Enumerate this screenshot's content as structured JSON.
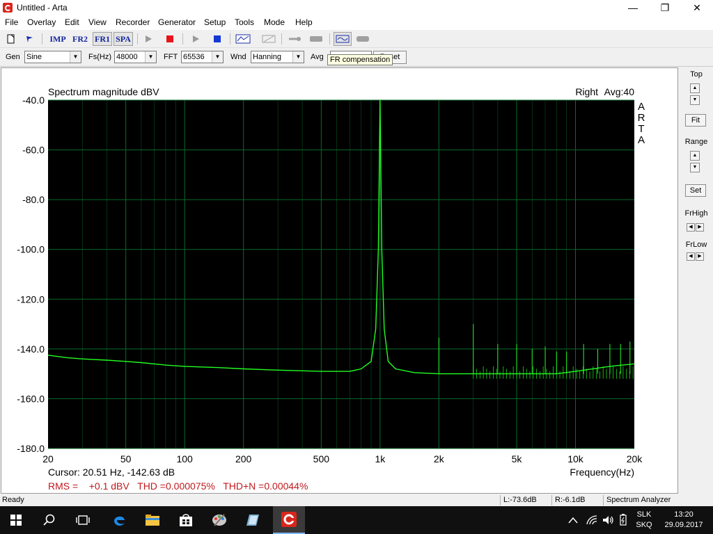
{
  "window": {
    "title": "Untitled - Arta"
  },
  "menu": [
    "File",
    "Overlay",
    "Edit",
    "View",
    "Recorder",
    "Generator",
    "Setup",
    "Tools",
    "Mode",
    "Help"
  ],
  "toolbar": {
    "imp": "IMP",
    "fr2": "FR2",
    "fr1": "FR1",
    "spa": "SPA"
  },
  "controls": {
    "gen_label": "Gen",
    "gen_value": "Sine",
    "fs_label": "Fs(Hz)",
    "fs_value": "48000",
    "fft_label": "FFT",
    "fft_value": "65536",
    "wnd_label": "Wnd",
    "wnd_value": "Hanning",
    "avg_label": "Avg",
    "reset_label": "Reset"
  },
  "tooltip": "FR compensation",
  "chart_data": {
    "type": "line",
    "title": "Spectrum magnitude dBV",
    "channel": "Right",
    "avg_text": "Avg:40",
    "brand": "ARTA",
    "xlabel": "Frequency(Hz)",
    "ylabel": "",
    "xscale": "log",
    "xlim": [
      20,
      20000
    ],
    "ylim": [
      -180,
      -40
    ],
    "yticks": [
      -40,
      -60,
      -80,
      -100,
      -120,
      -140,
      -160,
      -180
    ],
    "ytick_labels": [
      "-40.0",
      "-60.0",
      "-80.0",
      "-100.0",
      "-120.0",
      "-140.0",
      "-160.0",
      "-180.0"
    ],
    "xticks": [
      20,
      50,
      100,
      200,
      500,
      1000,
      2000,
      5000,
      10000,
      20000
    ],
    "xtick_labels": [
      "20",
      "50",
      "100",
      "200",
      "500",
      "1k",
      "2k",
      "5k",
      "10k",
      "20k"
    ],
    "grid": true,
    "background": "#000000",
    "grid_color": "#0a6b2a",
    "trace_color": "#22ff22",
    "series": [
      {
        "color": "#22ff22",
        "x": [
          20,
          25,
          30,
          40,
          50,
          60,
          80,
          100,
          150,
          200,
          300,
          500,
          700,
          800,
          900,
          950,
          980,
          1000,
          1020,
          1050,
          1100,
          1200,
          1500,
          2000,
          3000,
          5000,
          8000,
          10000,
          15000,
          20000
        ],
        "y": [
          -142.5,
          -143.5,
          -144,
          -144.5,
          -145,
          -145.5,
          -146.5,
          -147,
          -147.5,
          -148,
          -148.5,
          -149,
          -149,
          -148,
          -145,
          -132,
          -100,
          -40,
          -100,
          -132,
          -145,
          -148,
          -149.5,
          -150,
          -150,
          -150,
          -150,
          -149,
          -147,
          -146
        ]
      }
    ],
    "spikes": [
      {
        "x": 2000,
        "y": -135.5
      },
      {
        "x": 3000,
        "y": -130
      },
      {
        "x": 4000,
        "y": -138
      },
      {
        "x": 5000,
        "y": -138
      },
      {
        "x": 6000,
        "y": -140
      },
      {
        "x": 7000,
        "y": -139
      },
      {
        "x": 8000,
        "y": -141
      },
      {
        "x": 9000,
        "y": -141
      },
      {
        "x": 11000,
        "y": -138
      },
      {
        "x": 13000,
        "y": -140
      },
      {
        "x": 15000,
        "y": -138
      },
      {
        "x": 17000,
        "y": -138
      },
      {
        "x": 19000,
        "y": -137
      }
    ],
    "cursor_text": "Cursor: 20.51 Hz, -142.63 dB",
    "rms_text": "RMS =    +0.1 dBV   THD =0.000075%   THD+N =0.00044%"
  },
  "rightpanel": {
    "top_label": "Top",
    "fit_label": "Fit",
    "range_label": "Range",
    "set_label": "Set",
    "frhigh_label": "FrHigh",
    "frlow_label": "FrLow"
  },
  "status": {
    "ready": "Ready",
    "left_level": "L:-73.6dB",
    "right_level": "R:-6.1dB",
    "mode": "Spectrum Analyzer"
  },
  "taskbar": {
    "lang1": "SLK",
    "lang2": "SKQ",
    "time": "13:20",
    "date": "29.09.2017"
  }
}
